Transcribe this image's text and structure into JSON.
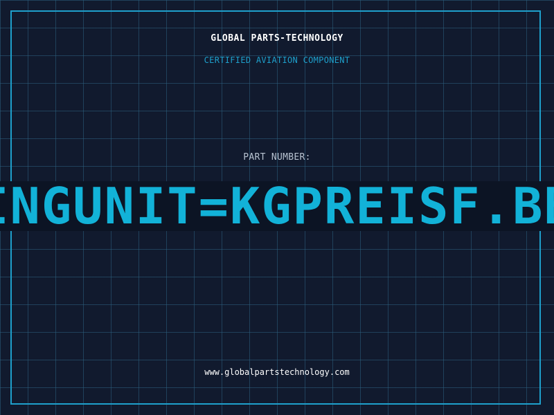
{
  "header": {
    "company": "GLOBAL PARTS-TECHNOLOGY",
    "subtitle": "CERTIFIED AVIATION COMPONENT"
  },
  "part": {
    "label": "PART NUMBER:",
    "value": "INGUNIT=KGPREISF.BB"
  },
  "footer": {
    "website": "www.globalpartstechnology.com"
  },
  "colors": {
    "background": "#111a2e",
    "accent": "#1ea0cc",
    "part_number": "#12b2d8"
  }
}
